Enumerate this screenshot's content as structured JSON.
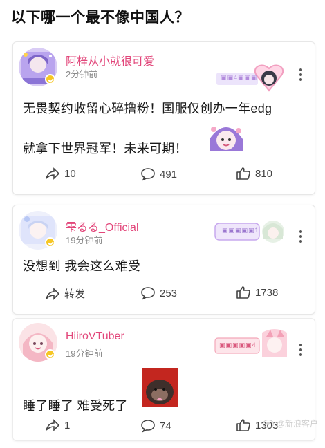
{
  "page": {
    "title": "以下哪一个最不像中国人？"
  },
  "posts": [
    {
      "username": "阿梓从小就很可爱",
      "time": "2分钟前",
      "medal_text": "▣▣4▣▣▣",
      "content_line1": "无畏契约收留心碎撸粉！国服仅创办一年edg",
      "content_line2": "就拿下世界冠军！未来可期！",
      "share": "10",
      "comments": "491",
      "likes": "810"
    },
    {
      "username": "雫るる_Official",
      "time": "19分钟前",
      "medal_text": "▣▣▣▣▣1",
      "content_line1": "没想到 我会这么难受",
      "share": "转发",
      "comments": "253",
      "likes": "1738"
    },
    {
      "username": "HiiroVTuber",
      "time": "19分钟前",
      "medal_text": "▣▣▣▣▣4",
      "content_line1": "睡了睡了 难受死了",
      "share": "1",
      "comments": "74",
      "likes": "1303"
    }
  ],
  "watermark": "@新浪客户",
  "colors": {
    "username": "#e2467a",
    "medal_bg": "#e8d9ff",
    "text": "#1a1a1a"
  }
}
